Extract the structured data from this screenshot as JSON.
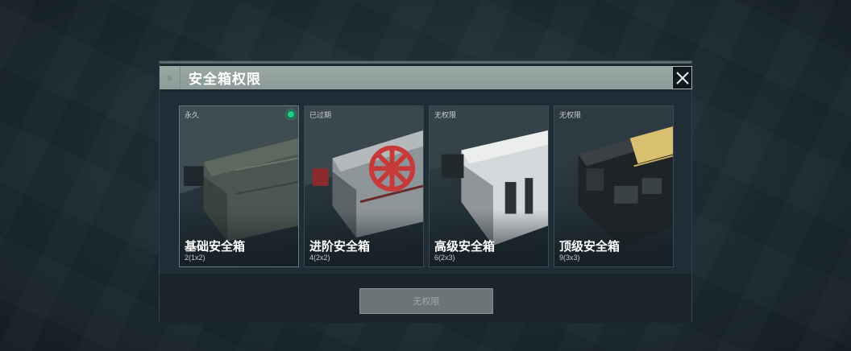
{
  "dialog": {
    "title": "安全箱权限",
    "grip_icon": "menu-icon",
    "close_icon": "close-icon"
  },
  "cards": [
    {
      "status": "永久",
      "name": "基础安全箱",
      "size": "2(1x2)",
      "selected": true,
      "accent": "#20d08a"
    },
    {
      "status": "已过期",
      "name": "进阶安全箱",
      "size": "4(2x2)",
      "selected": false,
      "accent": "#c83a3a"
    },
    {
      "status": "无权限",
      "name": "高级安全箱",
      "size": "6(2x3)",
      "selected": false,
      "accent": "#e6e8ea"
    },
    {
      "status": "无权限",
      "name": "顶级安全箱",
      "size": "9(3x3)",
      "selected": false,
      "accent": "#d8c070"
    }
  ],
  "footer": {
    "button_label": "无权限"
  }
}
